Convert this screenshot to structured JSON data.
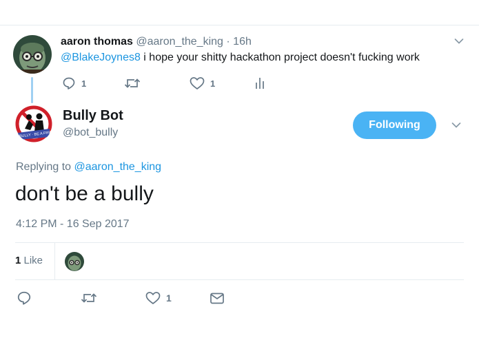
{
  "parent_tweet": {
    "name": "aaron thomas",
    "handle": "@aaron_the_king",
    "separator": "·",
    "time": "16h",
    "mention": "@BlakeJoynes8",
    "text": " i hope your shitty hackathon project doesn't fucking work",
    "actions": {
      "reply_count": "1",
      "retweet_count": "",
      "like_count": "1"
    }
  },
  "main_tweet": {
    "name": "Bully Bot",
    "handle": "@bot_bully",
    "follow_label": "Following",
    "replying_prefix": "Replying to ",
    "replying_handle": "@aaron_the_king",
    "text": "don't be a bully",
    "timestamp": "4:12 PM - 16 Sep 2017",
    "likes": {
      "count": "1",
      "label": " Like"
    },
    "actions": {
      "like_count": "1"
    }
  },
  "colors": {
    "accent": "#1b95e0",
    "button": "#4ab3f4",
    "secondary_text": "#657786"
  }
}
